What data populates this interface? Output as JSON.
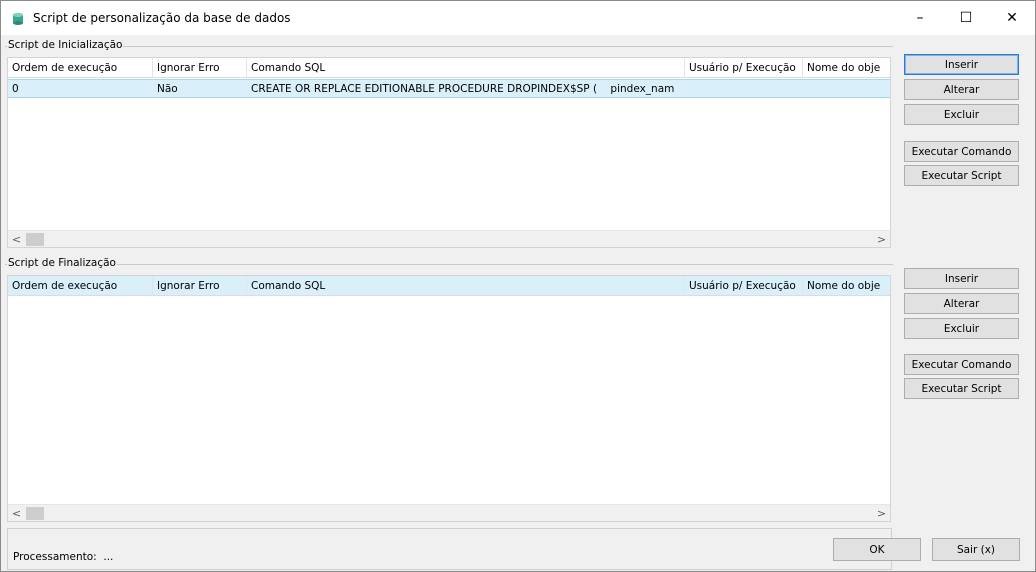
{
  "window": {
    "title": "Script de personalização da base de dados",
    "controls": {
      "minimize": "–",
      "maximize": "☐",
      "close": "✕"
    }
  },
  "init_section": {
    "title": "Script de Inicialização",
    "columns": [
      "Ordem de execução",
      "Ignorar Erro",
      "Comando SQL",
      "Usuário p/ Execução",
      "Nome do obje"
    ],
    "rows": [
      {
        "ordem": "0",
        "ignorar": "Não",
        "comando": "CREATE OR REPLACE EDITIONABLE PROCEDURE DROPINDEX$SP (    pindex_nam",
        "usuario": "",
        "nome": ""
      }
    ],
    "buttons": {
      "insert": "Inserir",
      "edit": "Alterar",
      "delete": "Excluir",
      "exec_command": "Executar Comando",
      "exec_script": "Executar Script"
    }
  },
  "final_section": {
    "title": "Script de Finalização",
    "columns": [
      "Ordem de execução",
      "Ignorar Erro",
      "Comando SQL",
      "Usuário p/ Execução",
      "Nome do obje"
    ],
    "rows": [],
    "buttons": {
      "insert": "Inserir",
      "edit": "Alterar",
      "delete": "Excluir",
      "exec_command": "Executar Comando",
      "exec_script": "Executar Script"
    }
  },
  "scroll": {
    "left": "<",
    "right": ">"
  },
  "footer": {
    "status_label": "Processamento:  ...",
    "ok": "OK",
    "exit": "Sair (x)"
  },
  "colors": {
    "selection": "#d9f0fb",
    "default_button_border": "#2a7bd3",
    "icon_teal": "#3aa88f"
  },
  "icons": {
    "app": "database-icon",
    "minimize": "minimize-icon",
    "maximize": "maximize-icon",
    "close": "close-icon"
  }
}
